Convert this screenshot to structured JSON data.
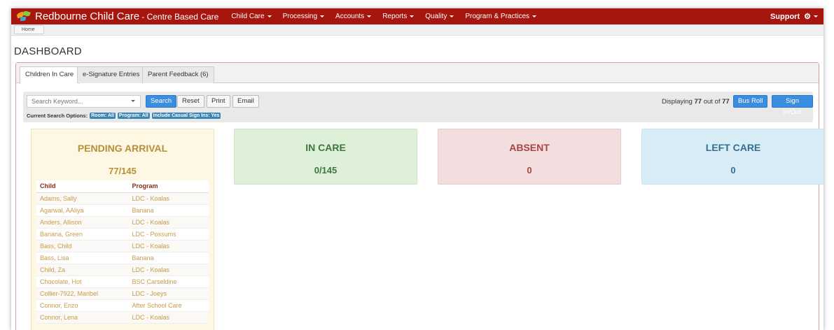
{
  "nav": {
    "brand_name": "Redbourne Child Care",
    "brand_sub": "- Centre Based Care",
    "items": [
      "Child Care",
      "Processing",
      "Accounts",
      "Reports",
      "Quality",
      "Program & Practices"
    ],
    "support": "Support"
  },
  "breadcrumb": {
    "home": "Home"
  },
  "page": {
    "title": "DASHBOARD"
  },
  "tabs": [
    "Children In Care",
    "e-Signature Entries",
    "Parent Feedback (6)"
  ],
  "search": {
    "placeholder": "Search Keyword...",
    "buttons": {
      "search": "Search",
      "reset": "Reset",
      "print": "Print",
      "email": "Email"
    },
    "displaying_prefix": "Displaying",
    "displaying_count": "77",
    "displaying_mid": "out of",
    "displaying_total": "77",
    "bus_roll": "Bus Roll",
    "sign_in_out": "Sign In/Out",
    "options_label": "Current Search Options:",
    "options": [
      "Room: All",
      "Program: All",
      "Include Casual Sign Ins: Yes"
    ]
  },
  "cards": {
    "pending": {
      "title": "PENDING ARRIVAL",
      "count": "77/145"
    },
    "in_care": {
      "title": "IN CARE",
      "count": "0/145"
    },
    "absent": {
      "title": "ABSENT",
      "count": "0"
    },
    "left_care": {
      "title": "LEFT CARE",
      "count": "0"
    }
  },
  "children_table": {
    "headers": [
      "Child",
      "Program"
    ],
    "rows": [
      [
        "Adams, Sally",
        "LDC - Koalas"
      ],
      [
        "Agarwal, AAliya",
        "Banana"
      ],
      [
        "Anders, Allison",
        "LDC - Koalas"
      ],
      [
        "Banana, Green",
        "LDC - Possums"
      ],
      [
        "Bass, Child",
        "LDC - Koalas"
      ],
      [
        "Bass, Lisa",
        "Banana"
      ],
      [
        "Child, Za",
        "LDC - Koalas"
      ],
      [
        "Chocolate, Hot",
        "BSC Carseldine"
      ],
      [
        "Collier-7922, Maribel",
        "LDC - Joeys"
      ],
      [
        "Connor, Enzo",
        "After School Care"
      ],
      [
        "Connor, Lena",
        "LDC - Koalas"
      ]
    ]
  },
  "colors": {
    "navbar": "#a6160e",
    "primary_button": "#3b8de0",
    "pending": "#b6913a",
    "in_care": "#3c763d",
    "absent": "#a94442",
    "left_care": "#31708f"
  }
}
